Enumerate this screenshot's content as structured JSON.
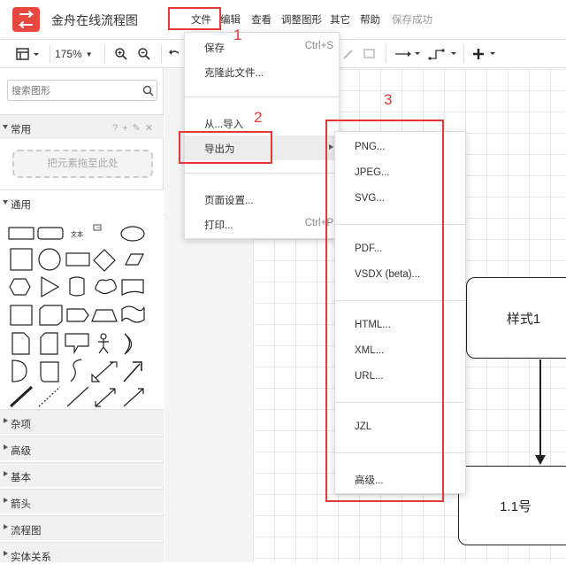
{
  "app": {
    "title": "金舟在线流程图"
  },
  "menubar": [
    {
      "label": "文件"
    },
    {
      "label": "编辑"
    },
    {
      "label": "查看"
    },
    {
      "label": "调整图形"
    },
    {
      "label": "其它"
    },
    {
      "label": "帮助"
    }
  ],
  "save_status": "保存成功",
  "toolbar": {
    "zoom": "175%"
  },
  "sidebar": {
    "search_placeholder": "搜索图形",
    "common_label": "常用",
    "common_tools": "? + ✎ ✕",
    "drop_zone": "把元素拖至此处",
    "general_label": "通用",
    "text_shape": "文本",
    "collapsed_sections": [
      "杂项",
      "高级",
      "基本",
      "箭头",
      "流程图",
      "实体关系"
    ]
  },
  "file_menu": {
    "items": [
      {
        "label": "保存",
        "shortcut": "Ctrl+S"
      },
      {
        "label": "克隆此文件..."
      },
      {
        "label": "从...导入"
      },
      {
        "label": "导出为"
      },
      {
        "label": "页面设置..."
      },
      {
        "label": "打印...",
        "shortcut": "Ctrl+P"
      }
    ]
  },
  "export_menu": {
    "items": [
      {
        "label": "PNG..."
      },
      {
        "label": "JPEG..."
      },
      {
        "label": "SVG..."
      },
      {
        "label": "PDF..."
      },
      {
        "label": "VSDX (beta)..."
      },
      {
        "label": "HTML..."
      },
      {
        "label": "XML..."
      },
      {
        "label": "URL..."
      },
      {
        "label": "JZL"
      },
      {
        "label": "高级..."
      }
    ]
  },
  "diagram": {
    "node1": "样式1",
    "node2": "1.1号"
  },
  "annotations": [
    "1",
    "2",
    "3"
  ],
  "colors": {
    "brand": "#e8473f",
    "annotation": "#e53935",
    "highlight": "#ececec"
  }
}
